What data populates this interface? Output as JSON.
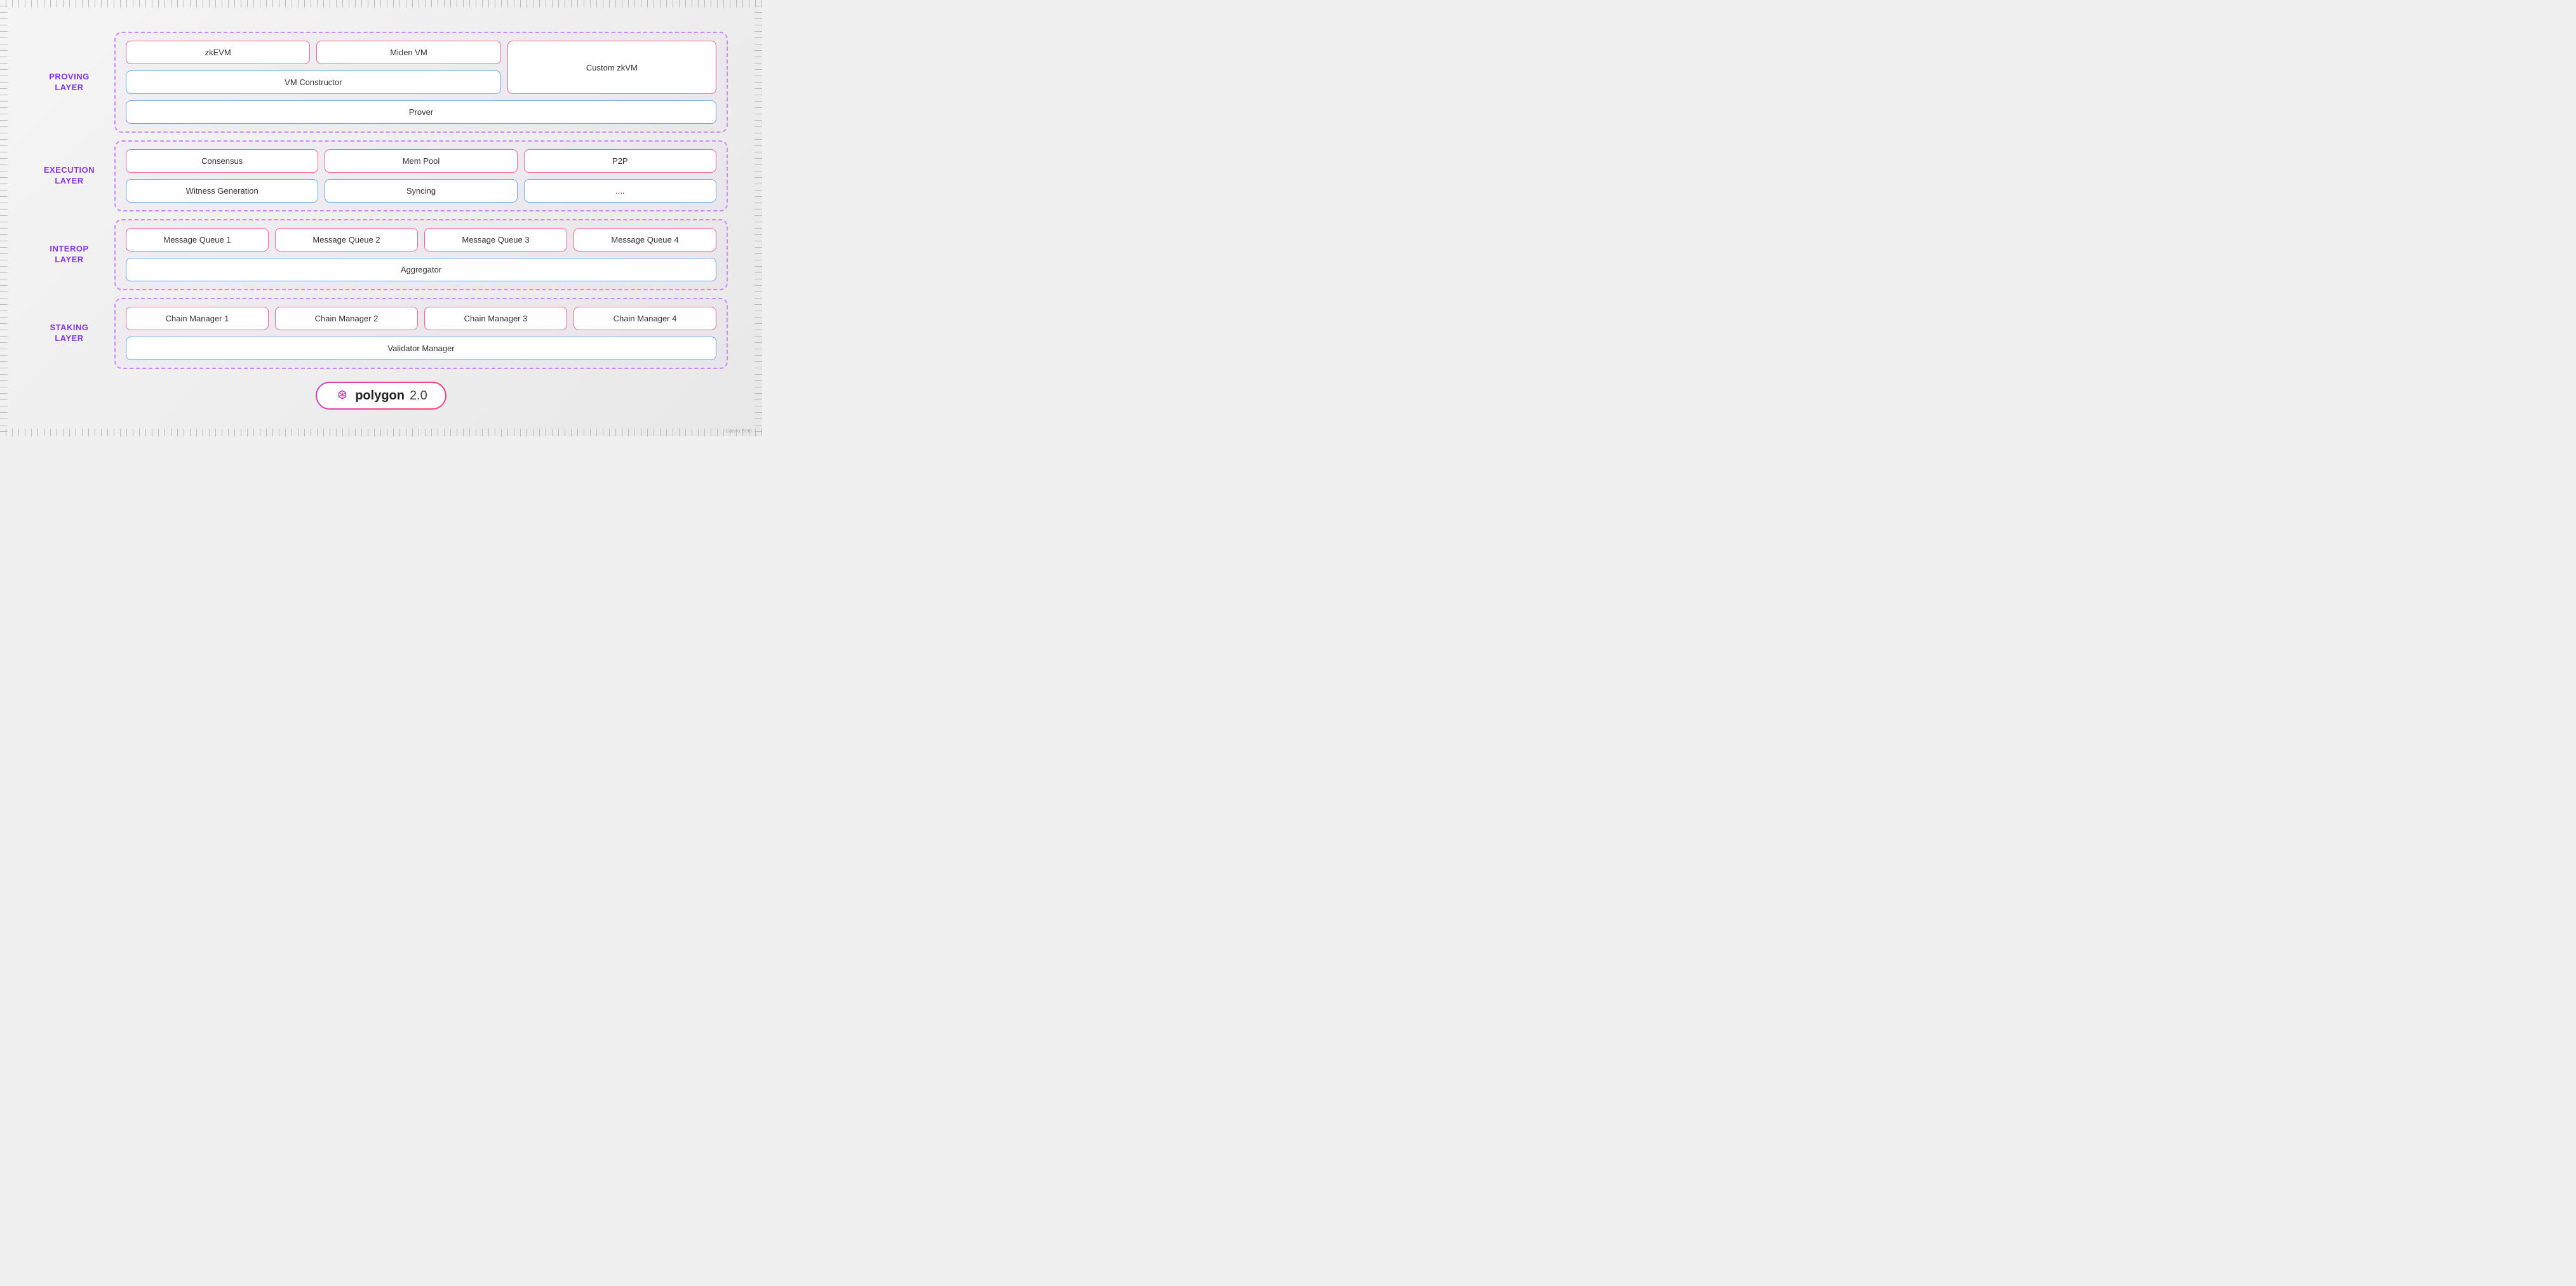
{
  "layers": {
    "proving": {
      "label": "PROVING\nLAYER",
      "components": {
        "row1_left": [
          "zkEVM",
          "Miden VM"
        ],
        "row1_right": "Custom zkVM",
        "row2": "VM Constructor",
        "row3": "Prover"
      }
    },
    "execution": {
      "label": "EXECUTION\nLAYER",
      "components": {
        "row1": [
          "Consensus",
          "Mem Pool",
          "P2P"
        ],
        "row2": [
          "Witness Generation",
          "Syncing",
          "...."
        ]
      }
    },
    "interop": {
      "label": "INTEROP\nLAYER",
      "components": {
        "row1": [
          "Message Queue 1",
          "Message Queue 2",
          "Message Queue 3",
          "Message Queue 4"
        ],
        "row2": "Aggregator"
      }
    },
    "staking": {
      "label": "STAKING\nLAYER",
      "components": {
        "row1": [
          "Chain Manager 1",
          "Chain Manager 2",
          "Chain Manager 3",
          "Chain Manager 4"
        ],
        "row2": "Validator Manager"
      }
    }
  },
  "badge": {
    "text_bold": "polygon",
    "text_version": "2.0"
  },
  "watermark": "Canva Beto"
}
